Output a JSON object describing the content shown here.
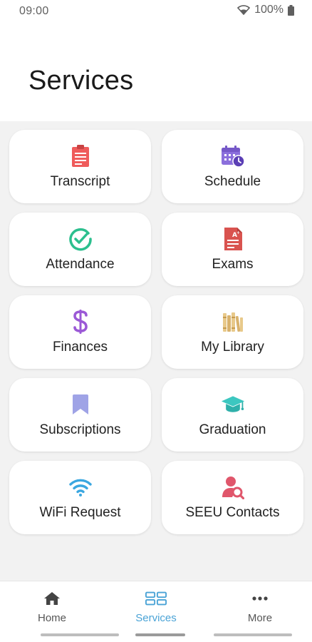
{
  "status_bar": {
    "time": "09:00",
    "battery": "100%"
  },
  "header": {
    "title": "Services"
  },
  "services": [
    {
      "label": "Transcript",
      "icon": "transcript-icon",
      "color": "#ef5b5b"
    },
    {
      "label": "Schedule",
      "icon": "calendar-clock-icon",
      "color": "#8b6fdc"
    },
    {
      "label": "Attendance",
      "icon": "check-circle-icon",
      "color": "#2cbf8e"
    },
    {
      "label": "Exams",
      "icon": "graded-document-icon",
      "color": "#d9534f"
    },
    {
      "label": "Finances",
      "icon": "dollar-icon",
      "color": "#9b59d6"
    },
    {
      "label": "My Library",
      "icon": "books-icon",
      "color": "#e8c98a"
    },
    {
      "label": "Subscriptions",
      "icon": "bookmark-icon",
      "color": "#9fa3e6"
    },
    {
      "label": "Graduation",
      "icon": "graduation-cap-icon",
      "color": "#3cc7c0"
    },
    {
      "label": "WiFi Request",
      "icon": "wifi-icon",
      "color": "#3ba7e0"
    },
    {
      "label": "SEEU Contacts",
      "icon": "contact-search-icon",
      "color": "#e0566b"
    }
  ],
  "bottom_nav": {
    "items": [
      {
        "label": "Home",
        "icon": "home-icon"
      },
      {
        "label": "Services",
        "icon": "grid-icon"
      },
      {
        "label": "More",
        "icon": "more-horizontal-icon"
      }
    ],
    "active_index": 1,
    "active_color": "#4aa3d6"
  }
}
